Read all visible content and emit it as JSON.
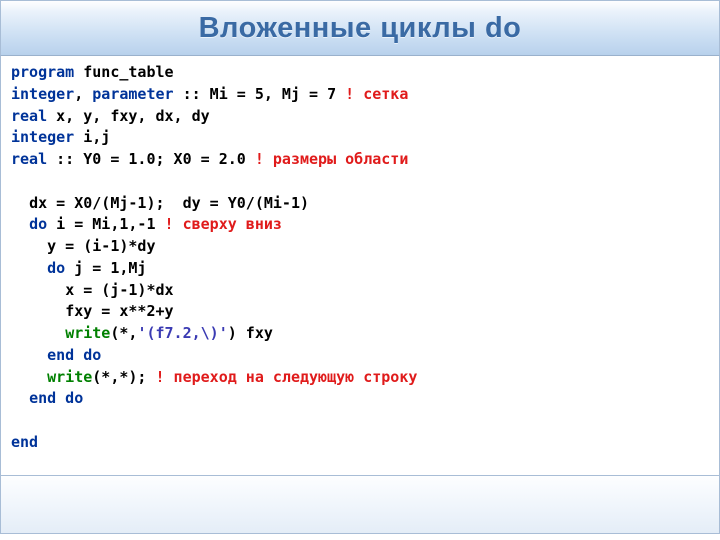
{
  "header": {
    "title": "Вложенные циклы do"
  },
  "code": {
    "l1": {
      "kw1": "program",
      "rest": " func_table"
    },
    "l2": {
      "kw1": "integer",
      "sep": ", ",
      "kw2": "parameter",
      "rest": " :: Mi = 5, Mj = 7 ",
      "cmt": "! сетка"
    },
    "l3": {
      "kw1": "real",
      "rest": " x, y, fxy, dx, dy"
    },
    "l4": {
      "kw1": "integer",
      "rest": " i,j"
    },
    "l5": {
      "kw1": "real",
      "rest": " :: Y0 = 1.0; X0 = 2.0 ",
      "cmt": "! размеры области"
    },
    "l6": {
      "rest": ""
    },
    "l7": {
      "indent": "  ",
      "rest": "dx = X0/(Mj-1);  dy = Y0/(Mi-1)"
    },
    "l8": {
      "indent": "  ",
      "kw1": "do",
      "rest": " i = Mi,1,-1 ",
      "cmt": "! сверху вниз"
    },
    "l9": {
      "indent": "    ",
      "rest": "y = (i-1)*dy"
    },
    "l10": {
      "indent": "    ",
      "kw1": "do",
      "rest": " j = 1,Mj"
    },
    "l11": {
      "indent": "      ",
      "rest": "x = (j-1)*dx"
    },
    "l12": {
      "indent": "      ",
      "rest": "fxy = x**2+y"
    },
    "l13": {
      "indent": "      ",
      "kw1": "write",
      "rest1": "(*,",
      "str": "'(f7.2,\\)'",
      "rest2": ") fxy"
    },
    "l14": {
      "indent": "    ",
      "kw1": "end do"
    },
    "l15": {
      "indent": "    ",
      "kw1": "write",
      "rest": "(*,*); ",
      "cmt": "! переход на следующую строку"
    },
    "l16": {
      "indent": "  ",
      "kw1": "end do"
    },
    "l17": {
      "rest": ""
    },
    "l18": {
      "kw1": "end"
    }
  }
}
